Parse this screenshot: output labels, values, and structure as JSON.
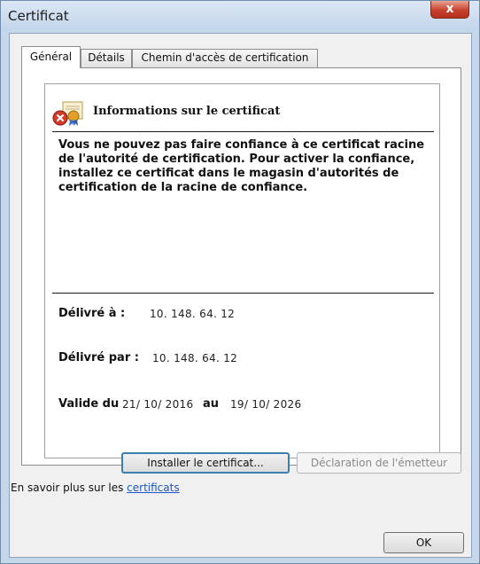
{
  "window": {
    "title": "Certificat",
    "close_glyph": "x"
  },
  "tabs": [
    {
      "label": "Général",
      "active": true
    },
    {
      "label": "Détails",
      "active": false
    },
    {
      "label": "Chemin d'accès de certification",
      "active": false
    }
  ],
  "cert_info": {
    "heading": "Informations sur le certificat",
    "icon": "certificate-error-icon",
    "warning": "Vous ne pouvez pas faire confiance à ce certificat racine de l'autorité de certification. Pour activer la confiance, installez ce certificat dans le magasin d'autorités de certification de la racine de confiance."
  },
  "fields": {
    "issued_to_label": "Délivré à :",
    "issued_to_value": "10. 148. 64. 12",
    "issued_by_label": "Délivré par :",
    "issued_by_value": "10. 148. 64. 12",
    "valid_from_label": "Valide du",
    "valid_from_value": "21/ 10/ 2016",
    "valid_to_label": "au",
    "valid_to_value": "19/ 10/ 2026"
  },
  "buttons": {
    "install": "Installer le certificat...",
    "issuer_statement": "Déclaration de l'émetteur",
    "ok": "OK"
  },
  "learn_more": {
    "text": "En savoir plus sur les ",
    "link": "certificats"
  },
  "colors": {
    "link": "#1a56c8",
    "close_button": "#c8412d",
    "title_bar": "#c3d5ea"
  }
}
